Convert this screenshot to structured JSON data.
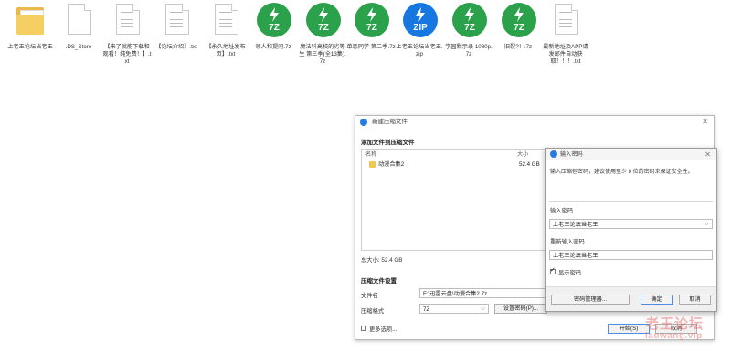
{
  "desktop": {
    "icons": [
      {
        "type": "folder",
        "name": "上老王论坛当老王"
      },
      {
        "type": "file",
        "name": ".DS_Store"
      },
      {
        "type": "file",
        "name": "【来了就能下载和观看！纯免费！】.txt"
      },
      {
        "type": "file",
        "name": "【论坛介绍】.txt"
      },
      {
        "type": "file",
        "name": "【永久地址发布页】.txt"
      },
      {
        "type": "7z",
        "badge": "7Z",
        "name": "领人和提问.7z"
      },
      {
        "type": "7z",
        "badge": "7Z",
        "name": "魔法科高校的劣等生 第三季(全13集).7z"
      },
      {
        "type": "7z",
        "badge": "7Z",
        "name": "单恋同学 第二季.7z"
      },
      {
        "type": "zip",
        "badge": "ZIP",
        "name": "上老王论坛当老王.zip"
      },
      {
        "type": "7z",
        "badge": "7Z",
        "name": "学园默示录 1080p.7z"
      },
      {
        "type": "7z",
        "badge": "7Z",
        "name": "旧裂?！.7z"
      },
      {
        "type": "file",
        "name": "最新地址及APP请发邮件自动获取！！！.txt"
      }
    ]
  },
  "compress_window": {
    "title": "新建压缩文件",
    "add_section": "添加文件到压缩文件",
    "col_name": "名称",
    "col_size": "大小",
    "items": [
      {
        "name": "动漫合集2",
        "size": "52.4 GB"
      }
    ],
    "total_size": "总大小: 52.4 GB",
    "settings_section": "压缩文件设置",
    "filename_label": "文件名",
    "filename_value": "F:\\迅雷云盘\\动漫合集2.7z",
    "format_label": "压缩格式",
    "format_value": "7Z",
    "set_password_button": "设置密码(P)...",
    "more_options": "更多选项...",
    "start_button": "开始(S)",
    "cancel_button": "取消"
  },
  "password_dialog": {
    "title": "输入密码",
    "instruction": "输入压缩包密码，建议使用至少 8 位的密码来保证安全性。",
    "password_label": "输入密码",
    "password_value": "上老王论坛当老王",
    "reenter_label": "重新输入密码",
    "reenter_value": "上老王论坛当老王",
    "show_password_label": "显示密码",
    "show_password_checked": true,
    "manager_button": "密码管理器...",
    "ok_button": "确定",
    "cancel_button": "取消"
  },
  "watermark": {
    "line1": "老王论坛",
    "line2": "laowang.vip"
  },
  "colors": {
    "archive_green": "#2aa14a",
    "zip_blue": "#1677e0",
    "folder_yellow": "#f6cf63",
    "app_blue": "#2a7be0"
  }
}
